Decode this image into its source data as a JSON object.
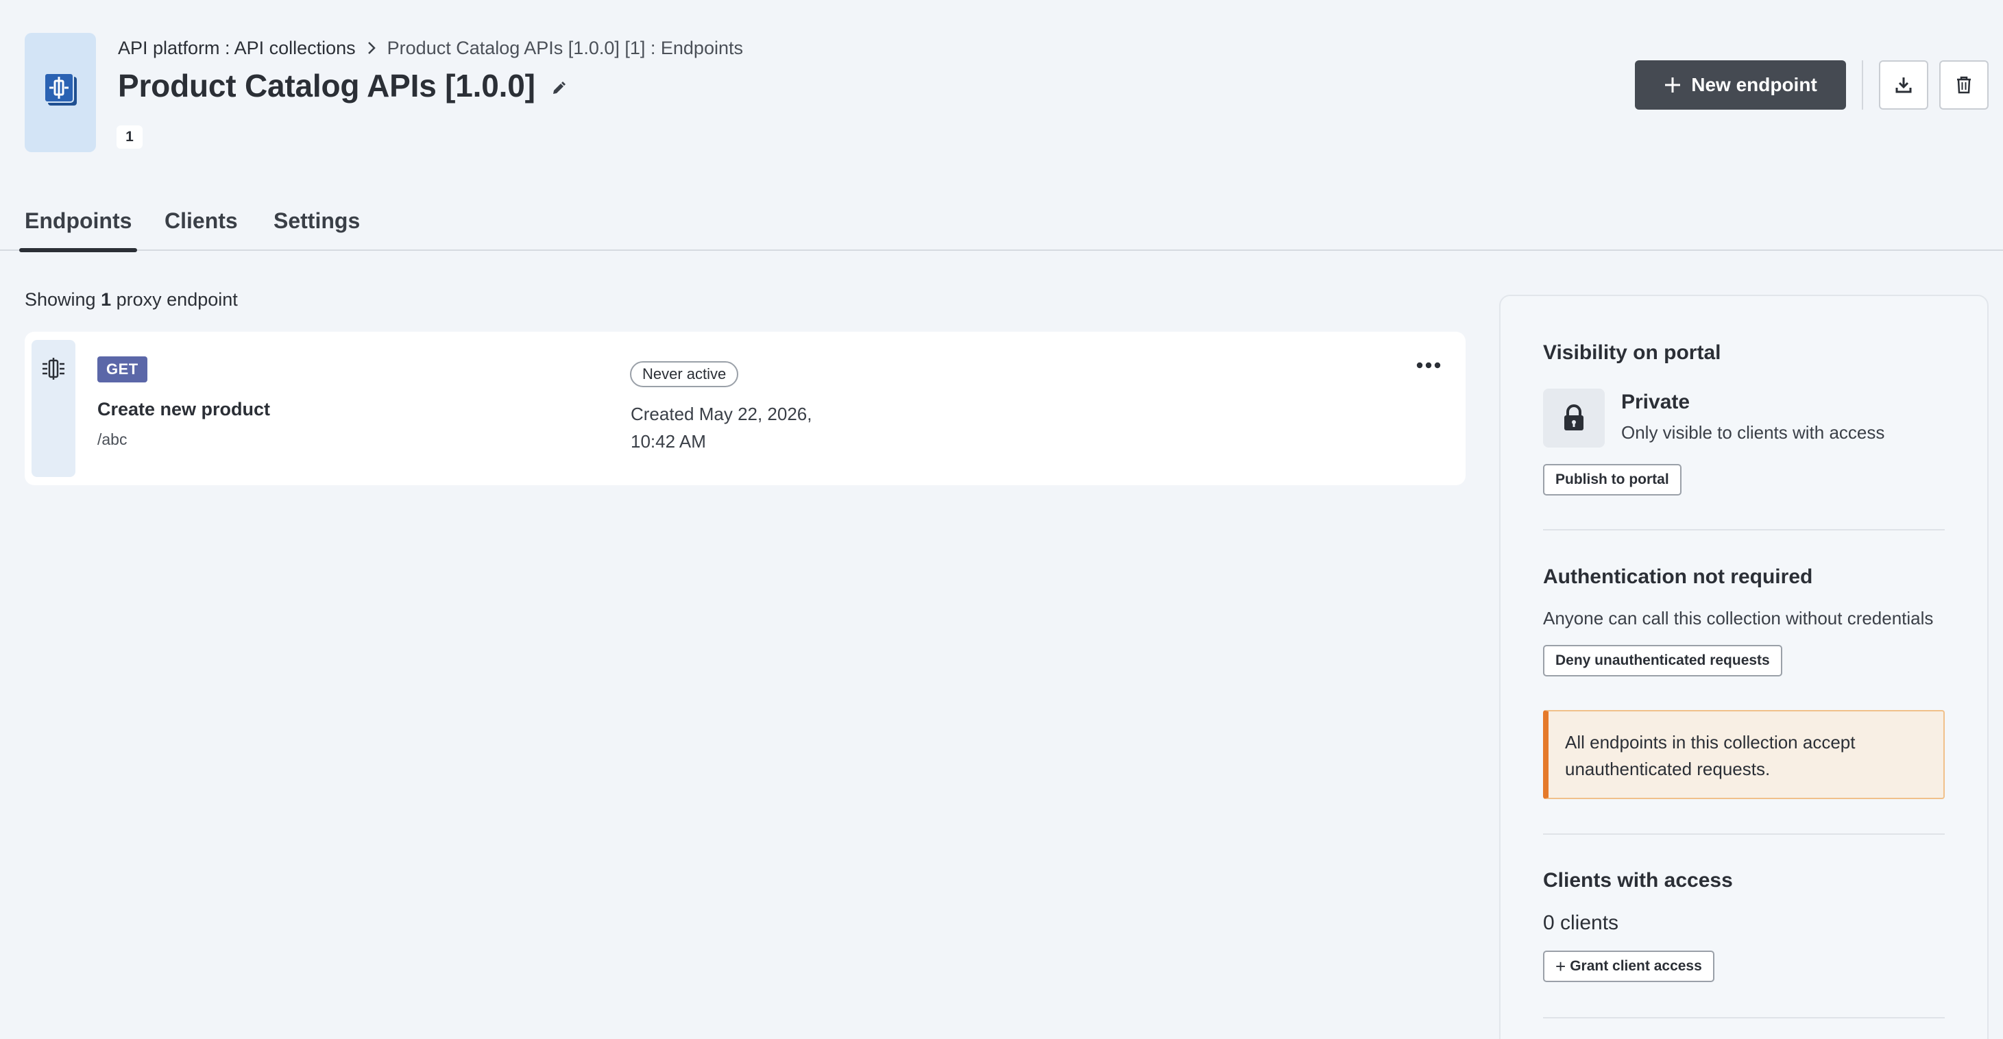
{
  "header": {
    "breadcrumb": {
      "parent": "API platform : API collections",
      "current": "Product Catalog APIs [1.0.0] [1] : Endpoints"
    },
    "title": "Product Catalog APIs [1.0.0]",
    "version_badge": "1",
    "new_endpoint_label": "New endpoint",
    "icons": [
      "collection-icon",
      "chevron-right-icon",
      "pencil-icon",
      "plus-icon",
      "download-icon",
      "trash-icon"
    ]
  },
  "tabs": [
    {
      "label": "Endpoints",
      "active": true
    },
    {
      "label": "Clients",
      "active": false
    },
    {
      "label": "Settings",
      "active": false
    }
  ],
  "list": {
    "showing_prefix": "Showing",
    "showing_count": "1",
    "showing_suffix": "proxy endpoint"
  },
  "endpoints": [
    {
      "method": "GET",
      "name": "Create new product",
      "path": "/abc",
      "status": "Never active",
      "created_line1": "Created May 22, 2026,",
      "created_line2": "10:42 AM"
    }
  ],
  "panel": {
    "visibility": {
      "heading": "Visibility on portal",
      "title": "Private",
      "subtitle": "Only visible to clients with access",
      "button": "Publish to portal"
    },
    "auth": {
      "heading": "Authentication not required",
      "text": "Anyone can call this collection without credentials",
      "button": "Deny unauthenticated requests",
      "warning_line1": "All endpoints in this collection accept",
      "warning_line2": "unauthenticated requests."
    },
    "clients": {
      "heading": "Clients with access",
      "count": "0 clients",
      "button": "Grant client access"
    }
  },
  "colors": {
    "background": "#f2f5f9",
    "primary_button": "#454a52",
    "method_badge": "#5b67a8",
    "warning_accent": "#e57a2a",
    "warning_bg": "#f8efe4",
    "icon_tile": "#d3e4f6"
  }
}
